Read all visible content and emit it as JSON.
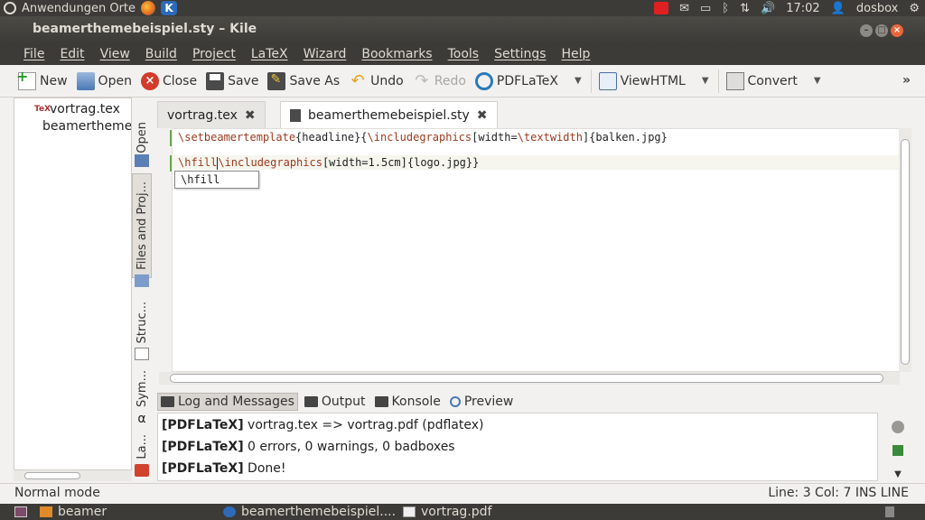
{
  "top_panel": {
    "places": "Anwendungen Orte",
    "kile_badge": "K",
    "time": "17:02",
    "user": "dosbox"
  },
  "window": {
    "title": "beamerthemebeispiel.sty – Kile"
  },
  "menu": [
    "File",
    "Edit",
    "View",
    "Build",
    "Project",
    "LaTeX",
    "Wizard",
    "Bookmarks",
    "Tools",
    "Settings",
    "Help"
  ],
  "toolbar": {
    "new": "New",
    "open": "Open",
    "close": "Close",
    "save": "Save",
    "save_as": "Save As",
    "undo": "Undo",
    "redo": "Redo",
    "pdflatex": "PDFLaTeX",
    "viewhtml": "ViewHTML",
    "convert": "Convert",
    "more": "»"
  },
  "files": [
    {
      "name": "vortrag.tex",
      "icon": "tex-file-icon"
    },
    {
      "name": "beamertheme",
      "icon": "dot-file-icon"
    }
  ],
  "side_tabs": [
    "Open",
    "Files and Proj...",
    "Struc...",
    "Sym...",
    "La..."
  ],
  "editor_tabs": [
    {
      "label": "vortrag.tex",
      "active": false
    },
    {
      "label": "beamerthemebeispiel.sty",
      "active": true
    }
  ],
  "editor": {
    "line1_cmd": "\\setbeamertemplate",
    "line1_a": "{headline}{",
    "line1_cmd2": "\\includegraphics",
    "line1_b": "[width=",
    "line1_cmd3": "\\textwidth",
    "line1_c": "]{balken.jpg}",
    "line3_cmd": "\\hfill",
    "line3_cmd2": "\\includegraphics",
    "line3_rest": "[width=1.5cm]{logo.jpg}}",
    "completion": "\\hfill"
  },
  "bottom_tabs": [
    {
      "label": "Log and Messages",
      "active": true
    },
    {
      "label": "Output",
      "active": false
    },
    {
      "label": "Konsole",
      "active": false
    },
    {
      "label": "Preview",
      "active": false
    }
  ],
  "log": [
    {
      "tag": "[PDFLaTeX]",
      "text": " vortrag.tex => vortrag.pdf (pdflatex)"
    },
    {
      "tag": "[PDFLaTeX]",
      "text": " 0 errors, 0 warnings, 0 badboxes"
    },
    {
      "tag": "[PDFLaTeX]",
      "text": " Done!"
    }
  ],
  "status": {
    "mode": "Normal mode",
    "position": "Line: 3 Col: 7  INS  LINE"
  },
  "taskbar": [
    "beamer",
    "beamerthemebeispiel....",
    "vortrag.pdf"
  ],
  "colors": {
    "panel": "#3c3b37",
    "keyword": "#9c3a1c",
    "change_bar": "#6aa84f"
  }
}
